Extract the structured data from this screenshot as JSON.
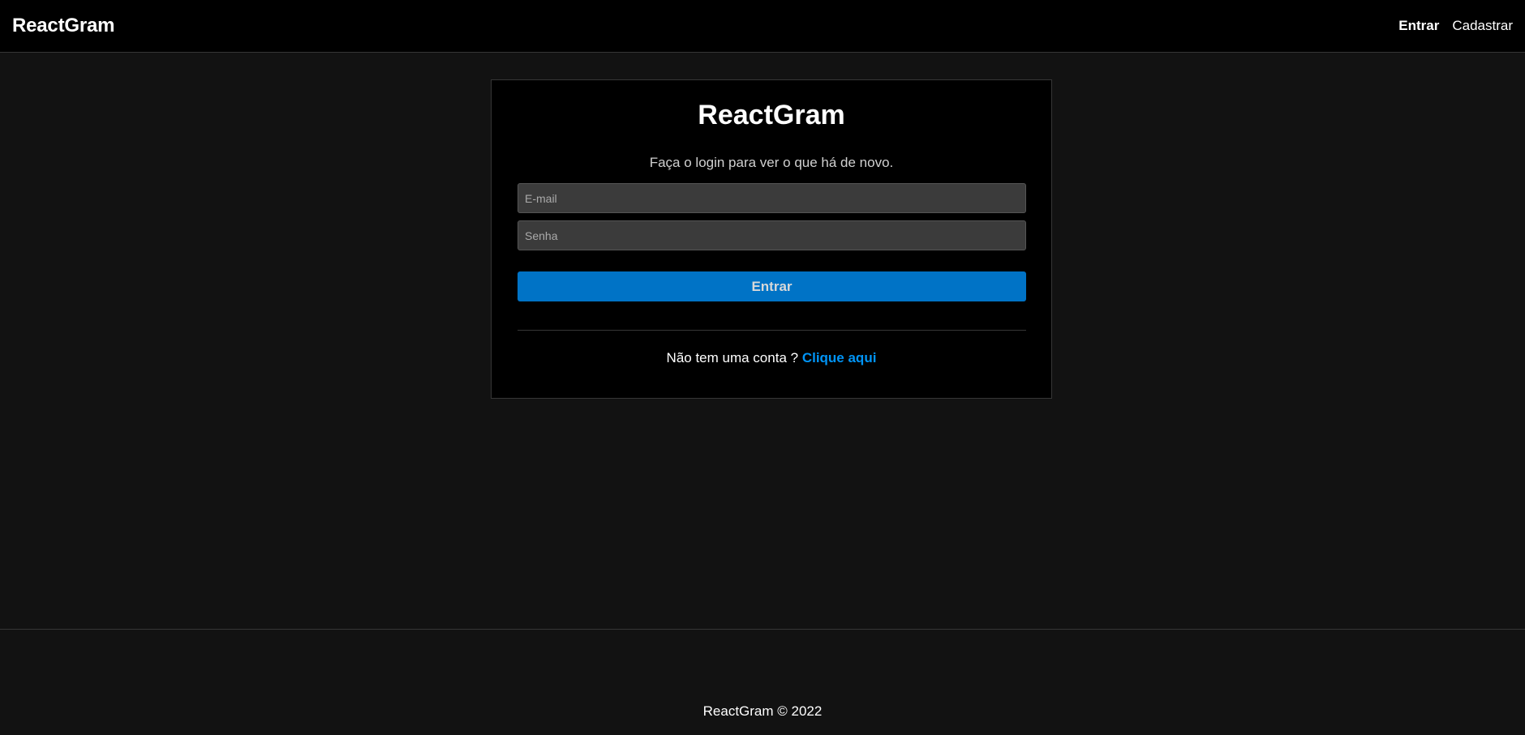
{
  "navbar": {
    "brand": "ReactGram",
    "links": [
      {
        "label": "Entrar",
        "active": true
      },
      {
        "label": "Cadastrar",
        "active": false
      }
    ]
  },
  "login": {
    "title": "ReactGram",
    "subtitle": "Faça o login para ver o que há de novo.",
    "email_placeholder": "E-mail",
    "email_value": "",
    "password_placeholder": "Senha",
    "password_value": "",
    "submit_label": "Entrar",
    "register_prompt": "Não tem uma conta ?",
    "register_link": "Clique aqui"
  },
  "footer": {
    "text": "ReactGram © 2022"
  },
  "colors": {
    "background": "#121212",
    "surface": "#000000",
    "border": "#363636",
    "input_bg": "#3b3b3b",
    "button_bg": "#0073c6",
    "link": "#0094f6"
  }
}
